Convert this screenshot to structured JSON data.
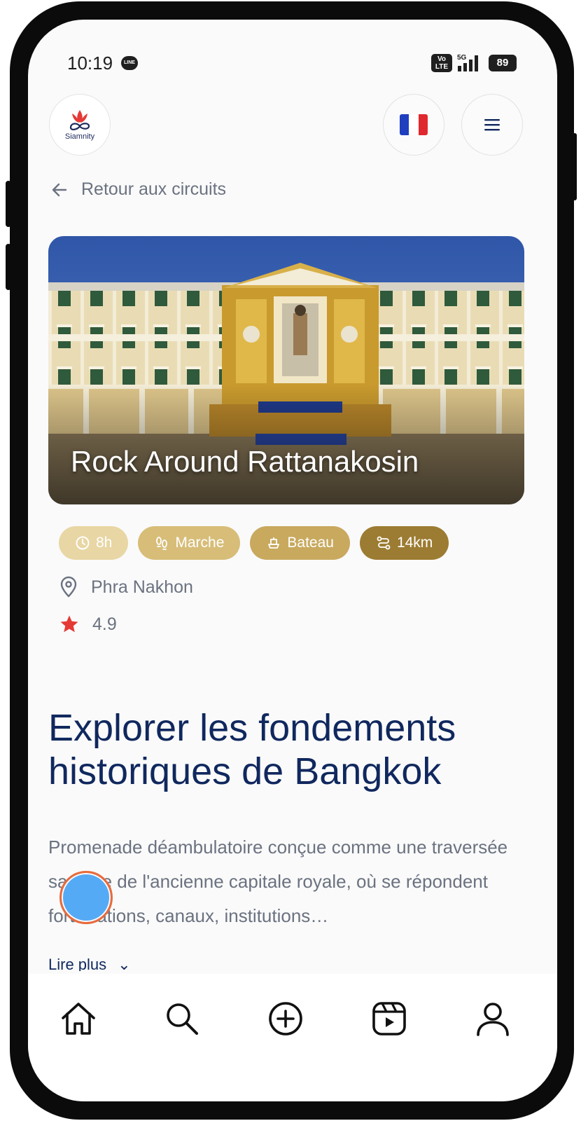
{
  "status": {
    "time": "10:19",
    "line_label": "LINE",
    "volte": "Vo LTE",
    "network": "5G",
    "battery": "89"
  },
  "brand": {
    "name": "Siamnity"
  },
  "header": {
    "back_label": "Retour aux circuits",
    "language_icon": "france-flag-icon",
    "menu_icon": "menu-icon"
  },
  "tour": {
    "title": "Rock Around Rattanakosin",
    "tags": [
      {
        "label": "8h",
        "icon": "clock-icon",
        "color": "#e8d6a4"
      },
      {
        "label": "Marche",
        "icon": "footprints-icon",
        "color": "#d7bd78"
      },
      {
        "label": "Bateau",
        "icon": "boat-icon",
        "color": "#c8a95e"
      },
      {
        "label": "14km",
        "icon": "route-icon",
        "color": "#9c7c32"
      }
    ],
    "location": "Phra Nakhon",
    "rating": "4.9"
  },
  "content": {
    "heading": "Explorer les fondements historiques de Bangkok",
    "description": "Promenade déambulatoire conçue comme une traversée savante de l'ancienne capitale royale, où se répondent fortifications, canaux, institutions…",
    "read_more": "Lire plus"
  },
  "nav": {
    "items": [
      {
        "icon": "home-icon"
      },
      {
        "icon": "search-icon"
      },
      {
        "icon": "add-icon"
      },
      {
        "icon": "reels-icon"
      },
      {
        "icon": "profile-icon"
      }
    ]
  },
  "colors": {
    "primary": "#10285e",
    "accent": "#e53935",
    "gold": "#9c7c32"
  }
}
